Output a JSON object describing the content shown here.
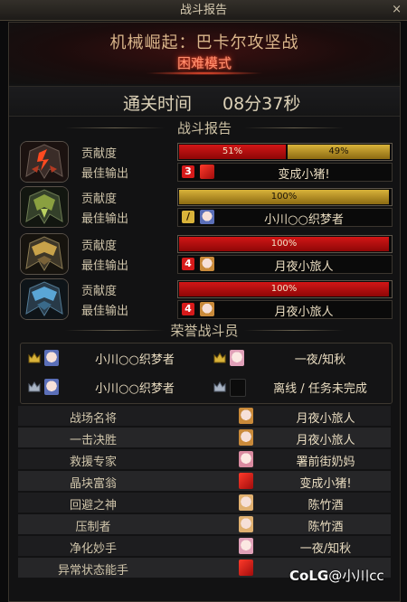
{
  "window": {
    "title": "战斗报告",
    "close": "×"
  },
  "header": {
    "dungeon": "机械崛起：巴卡尔攻坚战",
    "mode": "困难模式"
  },
  "clear_time": {
    "label": "通关时间",
    "value": "08分37秒"
  },
  "sections": {
    "report": "战斗报告",
    "honor": "荣誉战斗员"
  },
  "players": [
    {
      "avatar": "helmet-red-icon",
      "contribution_label": "贡献度",
      "best_label": "最佳输出",
      "segments": [
        {
          "pct": 51,
          "text": "51%",
          "color": "red"
        },
        {
          "pct": 49,
          "text": "49%",
          "color": "gold"
        }
      ],
      "job_icon": "3",
      "job_color": "#d61a1a",
      "best_name": "变成小猪!"
    },
    {
      "avatar": "helmet-green-icon",
      "contribution_label": "贡献度",
      "best_label": "最佳输出",
      "segments": [
        {
          "pct": 100,
          "text": "100%",
          "color": "gold"
        }
      ],
      "job_icon": "/",
      "job_color": "#d9b33a",
      "best_name": "小川○○织梦者"
    },
    {
      "avatar": "helmet-gold-icon",
      "contribution_label": "贡献度",
      "best_label": "最佳输出",
      "segments": [
        {
          "pct": 100,
          "text": "100%",
          "color": "red"
        }
      ],
      "job_icon": "4",
      "job_color": "#d61a1a",
      "best_name": "月夜小旅人"
    },
    {
      "avatar": "helmet-blue-icon",
      "contribution_label": "贡献度",
      "best_label": "最佳输出",
      "segments": [
        {
          "pct": 100,
          "text": "100%",
          "color": "red"
        }
      ],
      "job_icon": "4",
      "job_color": "#d61a1a",
      "best_name": "月夜小旅人"
    }
  ],
  "honor": [
    {
      "name": "小川○○织梦者",
      "crown": "crown-gold-icon"
    },
    {
      "name": "一夜/知秋",
      "crown": "crown-gold-icon"
    },
    {
      "name": "小川○○织梦者",
      "crown": "crown-silver-icon"
    },
    {
      "name": "离线 / 任务未完成",
      "crown": "crown-silver-icon"
    }
  ],
  "awards": [
    {
      "title": "战场名将",
      "player": "月夜小旅人"
    },
    {
      "title": "一击决胜",
      "player": "月夜小旅人"
    },
    {
      "title": "救援专家",
      "player": "署前街奶妈"
    },
    {
      "title": "晶块富翁",
      "player": "变成小猪!"
    },
    {
      "title": "回避之神",
      "player": "陈竹酒"
    },
    {
      "title": "压制者",
      "player": "陈竹酒"
    },
    {
      "title": "净化妙手",
      "player": "一夜/知秋"
    },
    {
      "title": "异常状态能手",
      "player": ""
    }
  ],
  "watermark": {
    "brand": "CoLG",
    "user": "@小川cc"
  }
}
